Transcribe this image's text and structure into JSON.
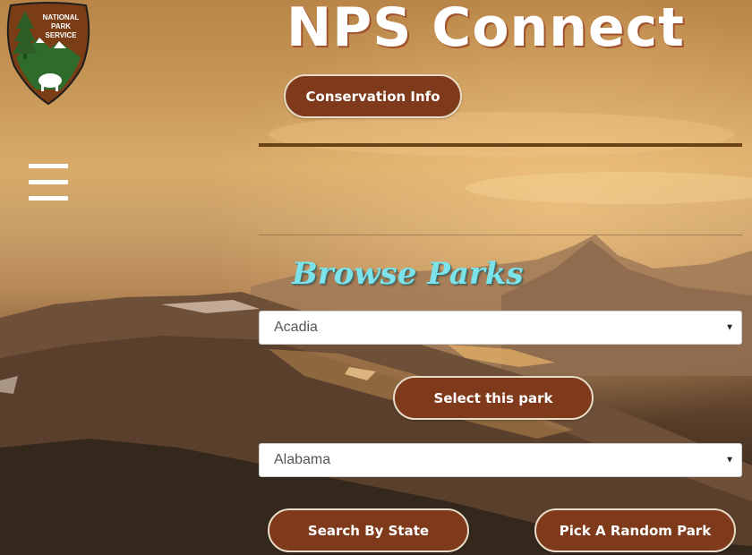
{
  "header": {
    "title": "NPS Connect",
    "logo": {
      "line1": "NATIONAL",
      "line2": "PARK",
      "line3": "SERVICE",
      "icon": "nps-arrowhead-logo"
    },
    "menu_icon": "hamburger-menu-icon",
    "conservation_button": "Conservation Info"
  },
  "browse": {
    "heading": "Browse Parks",
    "park_select": {
      "value": "Acadia",
      "icon": "chevron-down-icon"
    },
    "select_park_button": "Select this park",
    "state_select": {
      "value": "Alabama",
      "icon": "chevron-down-icon"
    },
    "search_state_button": "Search By State",
    "random_park_button": "Pick A Random Park"
  },
  "colors": {
    "button_bg": "#7e3a1b",
    "button_border": "#e9dcc7",
    "heading_accent": "#7de3ea",
    "divider": "#6b4218"
  }
}
